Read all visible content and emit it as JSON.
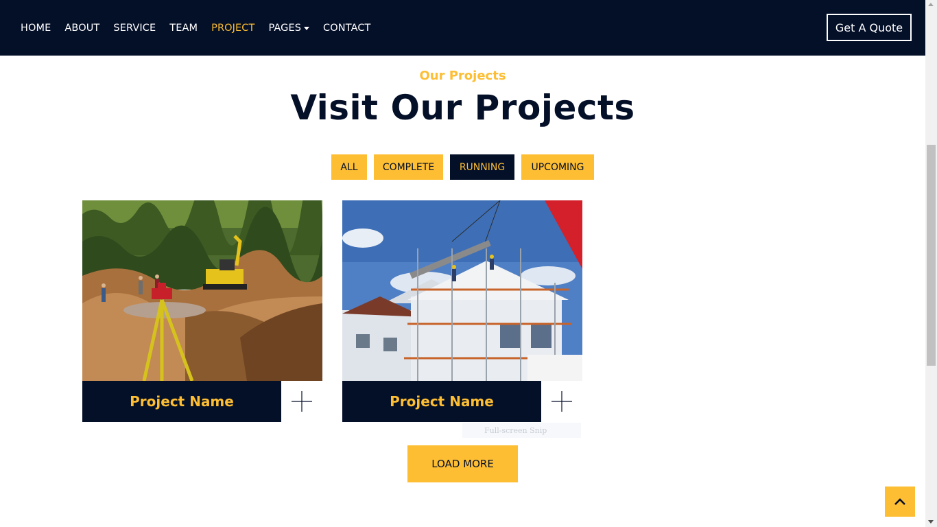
{
  "nav": {
    "links": [
      {
        "label": "HOME"
      },
      {
        "label": "ABOUT"
      },
      {
        "label": "SERVICE"
      },
      {
        "label": "TEAM"
      },
      {
        "label": "PROJECT"
      },
      {
        "label": "PAGES"
      },
      {
        "label": "CONTACT"
      }
    ],
    "active_link": "PROJECT",
    "quote_button": "Get A Quote"
  },
  "section": {
    "subtitle": "Our Projects",
    "title": "Visit Our Projects"
  },
  "filters": {
    "items": [
      {
        "label": "ALL"
      },
      {
        "label": "COMPLETE"
      },
      {
        "label": "RUNNING"
      },
      {
        "label": "UPCOMING"
      }
    ],
    "active": "RUNNING"
  },
  "projects": [
    {
      "name": "Project Name",
      "image": "construction-site-excavator-photo",
      "icon": "plus-icon"
    },
    {
      "name": "Project Name",
      "image": "scaffolding-crane-house-photo",
      "icon": "plus-icon"
    }
  ],
  "tooltip": "Full-screen Snip",
  "load_more": "LOAD MORE",
  "back_to_top_icon": "chevron-up-icon",
  "colors": {
    "navy": "#040f28",
    "accent": "#fdbe33",
    "white": "#ffffff"
  }
}
